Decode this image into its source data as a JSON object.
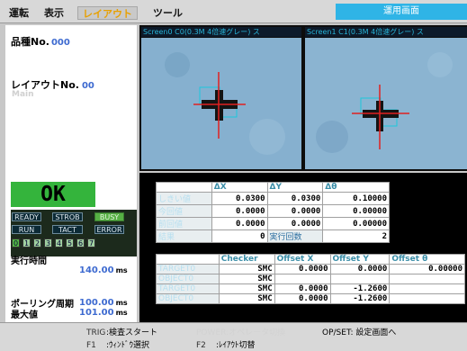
{
  "menu": {
    "items": [
      "運転",
      "表示",
      "レイアウト",
      "ツール"
    ],
    "active": 2
  },
  "mode_button": "運用画面",
  "left": {
    "product_label": "品種No.",
    "product_no": "000",
    "layout_label": "レイアウトNo.",
    "layout_no": "00",
    "layout_name": "Main",
    "result": "OK",
    "status": {
      "ready": "READY",
      "strob": "STROB",
      "busy": "BUSY",
      "run": "RUN",
      "tact": "TACT",
      "error": "ERROR"
    },
    "indicator_numbers": [
      "0",
      "1",
      "2",
      "3",
      "4",
      "5",
      "6",
      "7"
    ],
    "indicator_active": 0,
    "exec_time_label": "実行時間",
    "exec_time": "140.00",
    "exec_time_unit": "ms",
    "polling_label": "ポーリング周期",
    "polling": "100.00",
    "polling_unit": "ms",
    "max_label": "最大値",
    "max_value": "101.00",
    "max_unit": "ms"
  },
  "cameras": [
    {
      "header": "Screen0 C0(0.3M 4倍速グレー) ス"
    },
    {
      "header": "Screen1 C1(0.3M 4倍速グレー) ス"
    }
  ],
  "table1": {
    "headers": [
      "",
      "ΔX",
      "ΔY",
      "Δθ"
    ],
    "rows": [
      {
        "label": "しきい値",
        "values": [
          "0.0300",
          "0.0300",
          "0.10000"
        ]
      },
      {
        "label": "今回値",
        "values": [
          "0.0000",
          "0.0000",
          "0.00000"
        ]
      },
      {
        "label": "前回値",
        "values": [
          "0.0000",
          "0.0000",
          "0.00000"
        ]
      }
    ],
    "last_row": {
      "label": "結果",
      "value1": "0",
      "label2": "実行回数",
      "value2": "2"
    }
  },
  "table2": {
    "headers": [
      "",
      "Checker",
      "Offset X",
      "Offset Y",
      "Offset θ"
    ],
    "rows": [
      {
        "label": "TARGET0",
        "checker": "SMC",
        "x": "0.0000",
        "y": "0.0000",
        "t": "0.00000"
      },
      {
        "label": "OBJECT0",
        "checker": "SMC",
        "x": "",
        "y": "",
        "t": ""
      },
      {
        "label": "TARGET0",
        "checker": "SMC",
        "x": "0.0000",
        "y": "-1.2600",
        "t": ""
      },
      {
        "label": "OBJECT0",
        "checker": "SMC",
        "x": "0.0000",
        "y": "-1.2600",
        "t": ""
      }
    ]
  },
  "footer": {
    "trig_key": "TRIG",
    "trig_text": ":検査スタート",
    "mid_key": "POWER",
    "mid_text": ":オペレータ切換",
    "opset": "OP/SET: 設定画面へ",
    "f1_key": "F1",
    "f1_text": ":ｳｨﾝﾄﾞｳ選択",
    "f2_key": "F2",
    "f2_text": ":ﾚｲｱｳﾄ切替"
  }
}
